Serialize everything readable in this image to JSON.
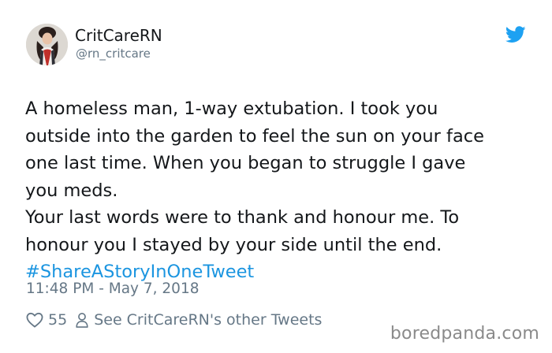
{
  "tweet": {
    "author": {
      "display_name": "CritCareRN",
      "handle": "@rn_critcare",
      "avatar_icon": "profile-photo"
    },
    "brand_icon": "twitter-bird-icon",
    "brand_color": "#1da1f2",
    "text_lines": [
      "A homeless man, 1-way extubation. I took you",
      "outside into the garden to feel the sun on your face",
      "one last time. When you began to struggle I gave",
      "you meds.",
      "Your last words were to thank and honour me. To",
      "honour you I stayed by your side until the end."
    ],
    "hashtag": "#ShareAStoryInOneTweet",
    "hashtag_color": "#1b95e0",
    "timestamp": "11:48 PM - May 7, 2018",
    "likes": {
      "icon": "heart-icon",
      "count": "55"
    },
    "other_tweets": {
      "icon": "person-icon",
      "label": "See CritCareRN's other Tweets"
    }
  },
  "watermark": {
    "text": "boredpanda.com"
  }
}
